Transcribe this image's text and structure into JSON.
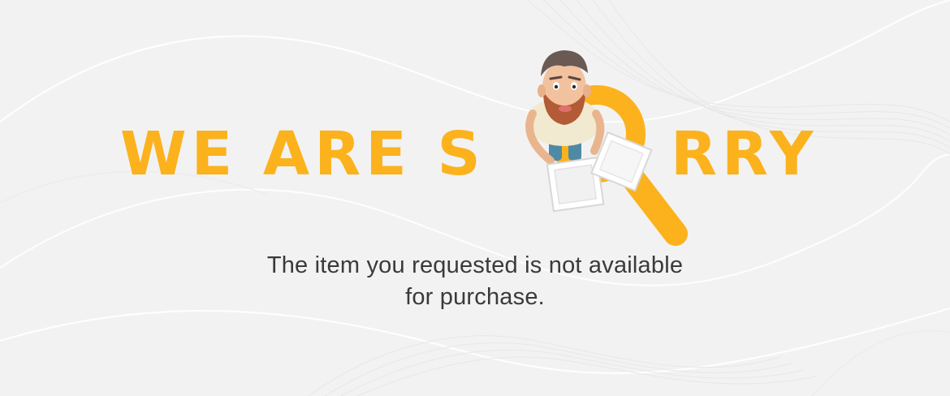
{
  "headline": {
    "left_text": "WE ARE S",
    "right_text": "RRY"
  },
  "message": {
    "line1": "The item you requested is not available",
    "line2": "for purchase."
  },
  "colors": {
    "accent": "#fbb21c",
    "background": "#f2f2f2",
    "text": "#3a3a3a"
  },
  "icons": {
    "magnifier": "magnifier-icon",
    "character": "confused-man-illustration"
  }
}
